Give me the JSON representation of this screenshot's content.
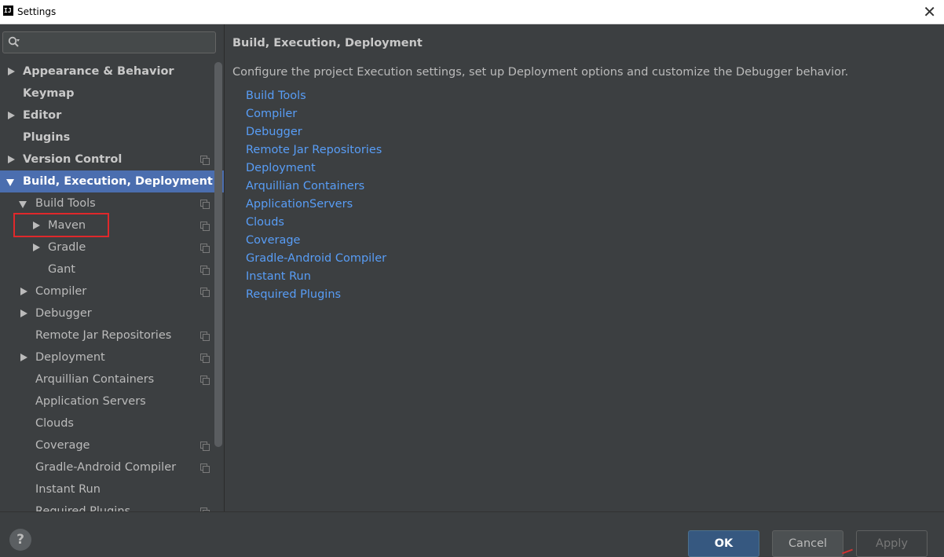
{
  "window": {
    "title": "Settings",
    "close_glyph": "✕"
  },
  "search": {
    "placeholder": "",
    "value": ""
  },
  "tree": [
    {
      "label": "Appearance & Behavior",
      "arrow": "right",
      "bold": true
    },
    {
      "label": "Keymap",
      "arrow": "none",
      "bold": true
    },
    {
      "label": "Editor",
      "arrow": "right",
      "bold": true
    },
    {
      "label": "Plugins",
      "arrow": "none",
      "bold": true
    },
    {
      "label": "Version Control",
      "arrow": "right",
      "bold": true,
      "copy_icon": true
    },
    {
      "label": "Build, Execution, Deployment",
      "arrow": "down",
      "bold": true,
      "selected": true
    },
    {
      "label": "Build Tools",
      "arrow": "down",
      "copy_icon": true
    },
    {
      "label": "Maven",
      "arrow": "right",
      "copy_icon": true,
      "highlighted": true
    },
    {
      "label": "Gradle",
      "arrow": "right",
      "copy_icon": true
    },
    {
      "label": "Gant",
      "arrow": "none",
      "copy_icon": true
    },
    {
      "label": "Compiler",
      "arrow": "right",
      "copy_icon": true
    },
    {
      "label": "Debugger",
      "arrow": "right"
    },
    {
      "label": "Remote Jar Repositories",
      "arrow": "none",
      "copy_icon": true
    },
    {
      "label": "Deployment",
      "arrow": "right",
      "copy_icon": true
    },
    {
      "label": "Arquillian Containers",
      "arrow": "none",
      "copy_icon": true
    },
    {
      "label": "Application Servers",
      "arrow": "none"
    },
    {
      "label": "Clouds",
      "arrow": "none"
    },
    {
      "label": "Coverage",
      "arrow": "none",
      "copy_icon": true
    },
    {
      "label": "Gradle-Android Compiler",
      "arrow": "none",
      "copy_icon": true
    },
    {
      "label": "Instant Run",
      "arrow": "none"
    },
    {
      "label": "Required Plugins",
      "arrow": "none",
      "copy_icon": true
    }
  ],
  "main": {
    "title": "Build, Execution, Deployment",
    "description": "Configure the project Execution settings, set up Deployment options and customize the Debugger behavior.",
    "links": [
      "Build Tools",
      "Compiler",
      "Debugger",
      "Remote Jar Repositories",
      "Deployment",
      "Arquillian Containers",
      "ApplicationServers",
      "Clouds",
      "Coverage",
      "Gradle-Android Compiler",
      "Instant Run",
      "Required Plugins"
    ]
  },
  "footer": {
    "help": "?",
    "ok": "OK",
    "cancel": "Cancel",
    "apply": "Apply"
  },
  "colors": {
    "selection": "#4b6eaf",
    "link": "#589df6",
    "highlight_box": "#e0282b"
  }
}
